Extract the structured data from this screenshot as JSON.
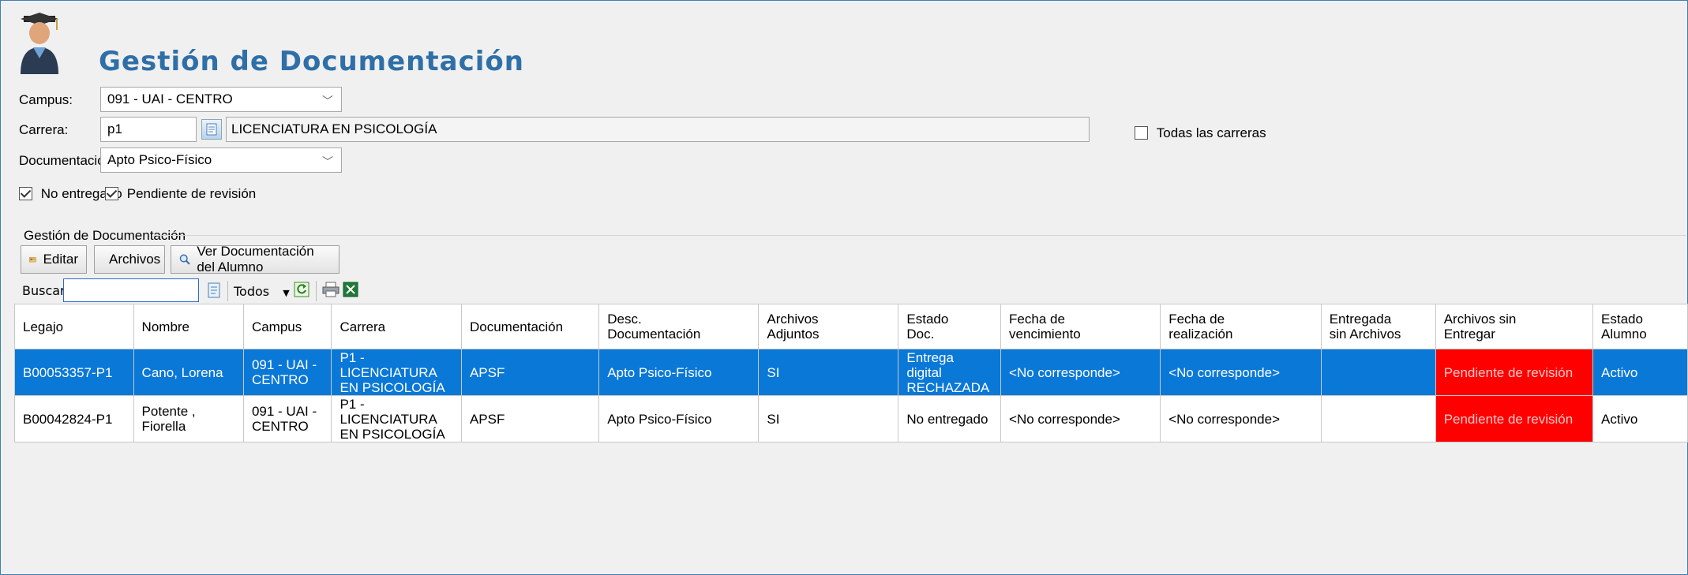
{
  "header": {
    "title": "Gestión de Documentación",
    "icon": "graduate-avatar-icon"
  },
  "filters": {
    "campus_label": "Campus:",
    "campus_value": "091 - UAI - CENTRO",
    "carrera_label": "Carrera:",
    "carrera_code": "p1",
    "carrera_name": "LICENCIATURA EN PSICOLOGÍA",
    "todas_carreras_label": "Todas las carreras",
    "todas_carreras_checked": false,
    "documentacion_label": "Documentación:",
    "documentacion_value": "Apto Psico-Físico",
    "no_entregado_label": "No entregado",
    "no_entregado_checked": true,
    "pendiente_label": "Pendiente de revisión",
    "pendiente_checked": true
  },
  "group": {
    "title": "Gestión de Documentación",
    "buttons": {
      "editar": "Editar",
      "archivos": "Archivos",
      "ver_doc": "Ver Documentación del Alumno"
    }
  },
  "search": {
    "label": "Buscar:",
    "value": "",
    "filter_value": "Todos"
  },
  "grid": {
    "headers": {
      "legajo": "Legajo",
      "nombre": "Nombre",
      "campus": "Campus",
      "carrera": "Carrera",
      "documentacion": "Documentación",
      "desc_doc_1": "Desc.",
      "desc_doc_2": "Documentación",
      "archivos_1": "Archivos",
      "archivos_2": "Adjuntos",
      "estado_doc_1": "Estado",
      "estado_doc_2": "Doc.",
      "fecha_venc_1": "Fecha de",
      "fecha_venc_2": "vencimiento",
      "fecha_real_1": "Fecha de",
      "fecha_real_2": "realización",
      "entregada_1": "Entregada",
      "entregada_2": "sin Archivos",
      "archivos_sin_1": "Archivos sin",
      "archivos_sin_2": "Entregar",
      "estado_alumno_1": "Estado",
      "estado_alumno_2": "Alumno"
    },
    "rows": [
      {
        "legajo": "B00053357-P1",
        "nombre_1": "Cano, Lorena",
        "nombre_2": "",
        "campus_1": "091 - UAI -",
        "campus_2": "CENTRO",
        "carrera_1": "P1 -",
        "carrera_2": "LICENCIATURA",
        "carrera_3": "EN PSICOLOGÍA",
        "documentacion": "APSF",
        "desc": "Apto Psico-Físico",
        "archivos": "SI",
        "estado_1": "Entrega digital",
        "estado_2": "RECHAZADA",
        "fecha_venc": "<No corresponde>",
        "fecha_real": "<No corresponde>",
        "entregada": "",
        "archivos_sin": "Pendiente de revisión",
        "estado_alumno": "Activo"
      },
      {
        "legajo": "B00042824-P1",
        "nombre_1": "Potente ,",
        "nombre_2": "Fiorella",
        "campus_1": "091 - UAI -",
        "campus_2": "CENTRO",
        "carrera_1": "P1 -",
        "carrera_2": "LICENCIATURA",
        "carrera_3": "EN PSICOLOGÍA",
        "documentacion": "APSF",
        "desc": "Apto Psico-Físico",
        "archivos": "SI",
        "estado_1": "No entregado",
        "estado_2": "",
        "fecha_venc": "<No corresponde>",
        "fecha_real": "<No corresponde>",
        "entregada": "",
        "archivos_sin": "Pendiente de revisión",
        "estado_alumno": "Activo"
      }
    ]
  },
  "colors": {
    "title": "#2f6fa8",
    "selection": "#0a78d7",
    "alert": "#ff0000"
  }
}
